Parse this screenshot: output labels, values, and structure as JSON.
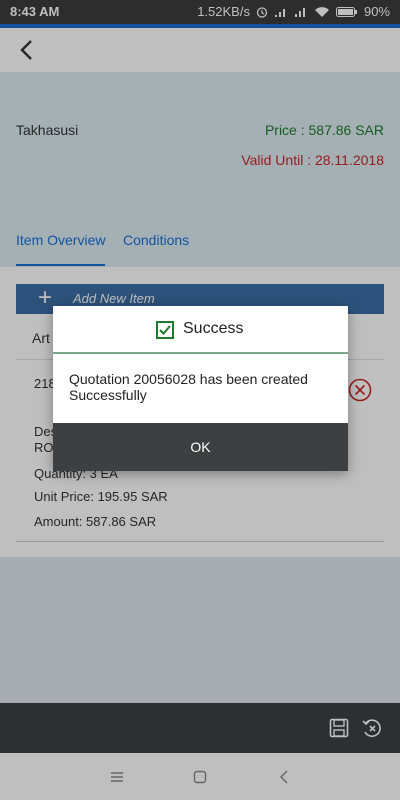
{
  "status_bar": {
    "time": "8:43 AM",
    "speed": "1.52KB/s",
    "battery": "90%"
  },
  "header": {
    "customer": "Takhasusi",
    "price": "Price : 587.86 SAR",
    "valid_until": "Valid Until : 28.11.2018"
  },
  "tabs": [
    {
      "label": "Item Overview",
      "active": true
    },
    {
      "label": "Conditions",
      "active": false
    }
  ],
  "item_list": {
    "add_label": "Add New Item",
    "header_partial": "Art",
    "item": {
      "number_partial": "218",
      "description_partial": "Des",
      "description_value_partial": "RO",
      "quantity": "Quantity:  3 EA",
      "unit_price": "Unit Price:  195.95 SAR",
      "amount": "Amount:  587.86 SAR"
    }
  },
  "dialog": {
    "title": "Success",
    "message": "Quotation 20056028 has been created Successfully",
    "ok_label": "OK"
  },
  "icons": {
    "back": "chevron-left-icon",
    "success": "checkbox-checked-icon",
    "delete": "circle-x-icon",
    "save": "save-icon",
    "revert": "revert-icon"
  },
  "colors": {
    "accent": "#1a6fd6",
    "price_green": "#1e7a2d",
    "valid_red": "#c62828",
    "header_bg": "#dcebf0",
    "toolbar_bg": "#3e3f40"
  }
}
